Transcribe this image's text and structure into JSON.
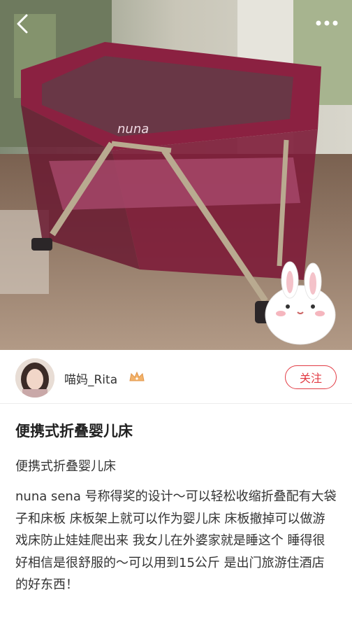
{
  "header": {
    "back_icon": "chevron-left-icon",
    "more_icon": "more-dots-icon"
  },
  "photo": {
    "brand_mark": "nuna"
  },
  "author": {
    "name": "喵妈_Rita",
    "badge_icon": "crown-icon",
    "follow_label": "关注",
    "accent_color": "#e23b44"
  },
  "post": {
    "title": "便携式折叠婴儿床",
    "subtitle": "便携式折叠婴儿床",
    "body": "nuna sena 号称得奖的设计～可以轻松收缩折叠配有大袋子和床板 床板架上就可以作为婴儿床 床板撤掉可以做游戏床防止娃娃爬出来 我女儿在外婆家就是睡这个 睡得很好相信是很舒服的～可以用到15公斤 是出门旅游住酒店的好东西！"
  }
}
